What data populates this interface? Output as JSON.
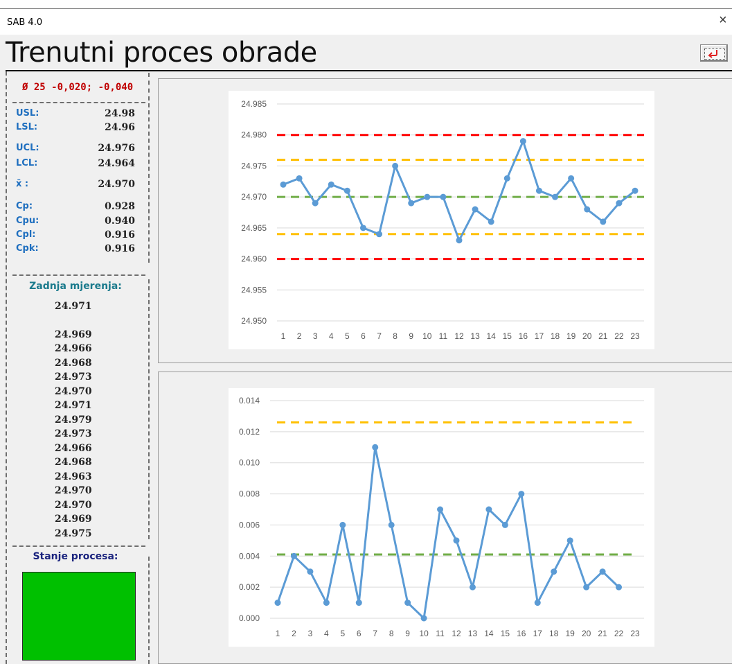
{
  "app_title": "SAB 4.0",
  "window_controls": {
    "close": "×"
  },
  "page_title": "Trenutni proces obrade",
  "spec": "Ø 25 -0,020; -0,040",
  "stats": [
    {
      "label": "USL:",
      "value": "24.98"
    },
    {
      "label": "LSL:",
      "value": "24.96"
    },
    {
      "label": "UCL:",
      "value": "24.976"
    },
    {
      "label": "LCL:",
      "value": "24.964"
    },
    {
      "label": "x̄ :",
      "value": "24.970"
    },
    {
      "label": "Cp:",
      "value": "0.928"
    },
    {
      "label": "Cpu:",
      "value": "0.940"
    },
    {
      "label": "Cpl:",
      "value": "0.916"
    },
    {
      "label": "Cpk:",
      "value": "0.916"
    }
  ],
  "last_measurements_title": "Zadnja mjerenja:",
  "last_measurements": [
    "24.971",
    "",
    "24.969",
    "24.966",
    "24.968",
    "24.973",
    "24.970",
    "24.971",
    "24.979",
    "24.973",
    "24.966",
    "24.968",
    "24.963",
    "24.970",
    "24.970",
    "24.969",
    "24.975"
  ],
  "process_state_title": "Stanje procesa:",
  "colors": {
    "spec_red": "#c00000",
    "label_blue": "#1f6fbf",
    "title_teal": "#1a7a8c",
    "title_navy": "#1a237e",
    "status_green": "#00c000",
    "series": "#5b9bd5",
    "usl_lsl": "#ff0000",
    "ucl_lcl": "#ffc000",
    "center": "#70ad47"
  },
  "chart_data": [
    {
      "type": "line",
      "x": [
        1,
        2,
        3,
        4,
        5,
        6,
        7,
        8,
        9,
        10,
        11,
        12,
        13,
        14,
        15,
        16,
        17,
        18,
        19,
        20,
        21,
        22,
        23
      ],
      "series": [
        {
          "values": [
            24.972,
            24.973,
            24.969,
            24.972,
            24.971,
            24.965,
            24.964,
            24.975,
            24.969,
            24.97,
            24.97,
            24.963,
            24.968,
            24.966,
            24.973,
            24.979,
            24.971,
            24.97,
            24.973,
            24.968,
            24.966,
            24.969,
            24.971
          ]
        }
      ],
      "reference_lines": [
        {
          "value": 24.98,
          "color": "#ff0000",
          "style": "dashed"
        },
        {
          "value": 24.96,
          "color": "#ff0000",
          "style": "dashed"
        },
        {
          "value": 24.976,
          "color": "#ffc000",
          "style": "dashed"
        },
        {
          "value": 24.964,
          "color": "#ffc000",
          "style": "dashed"
        },
        {
          "value": 24.97,
          "color": "#70ad47",
          "style": "dashed"
        }
      ],
      "yticks": [
        "24.950",
        "24.955",
        "24.960",
        "24.965",
        "24.970",
        "24.975",
        "24.980",
        "24.985"
      ],
      "ylim": [
        24.95,
        24.985
      ],
      "grid": true
    },
    {
      "type": "line",
      "x": [
        1,
        2,
        3,
        4,
        5,
        6,
        7,
        8,
        9,
        10,
        11,
        12,
        13,
        14,
        15,
        16,
        17,
        18,
        19,
        20,
        21,
        22,
        23
      ],
      "series": [
        {
          "values": [
            0.001,
            0.004,
            0.003,
            0.001,
            0.006,
            0.001,
            0.011,
            0.006,
            0.001,
            0.0,
            0.007,
            0.005,
            0.002,
            0.007,
            0.006,
            0.008,
            0.001,
            0.003,
            0.005,
            0.002,
            0.003,
            0.002
          ]
        }
      ],
      "reference_lines": [
        {
          "value": 0.0126,
          "color": "#ffc000",
          "style": "dashed"
        },
        {
          "value": 0.0041,
          "color": "#70ad47",
          "style": "dashed"
        }
      ],
      "yticks": [
        "0.000",
        "0.002",
        "0.004",
        "0.006",
        "0.008",
        "0.010",
        "0.012",
        "0.014"
      ],
      "ylim": [
        0,
        0.014
      ],
      "grid": true
    }
  ]
}
